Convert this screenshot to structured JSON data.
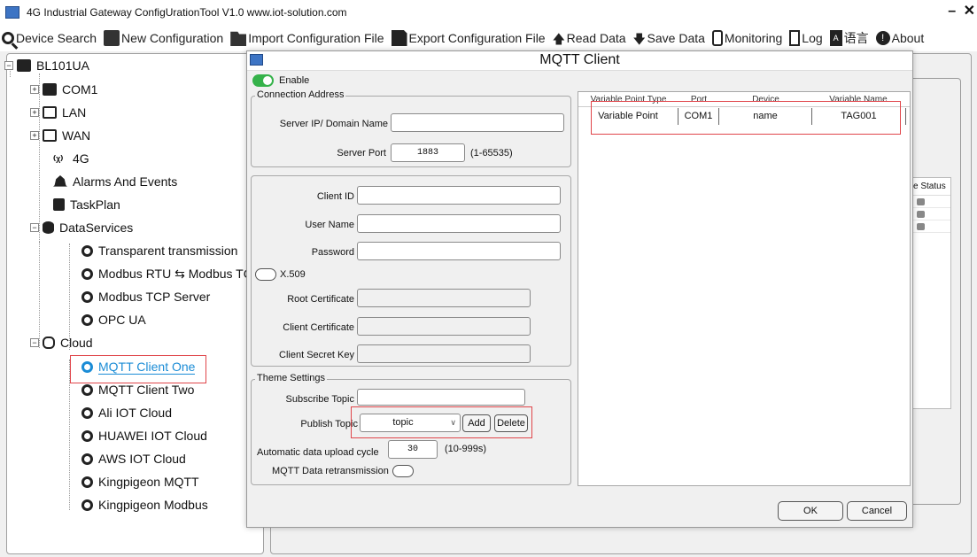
{
  "window": {
    "title": "4G Industrial Gateway ConfigUrationTool V1.0 www.iot-solution.com",
    "minimize": "–",
    "close": "✕"
  },
  "toolbar": {
    "items": [
      {
        "label": "Device Search",
        "icon": "search-icon"
      },
      {
        "label": "New Configuration",
        "icon": "new-config-icon"
      },
      {
        "label": "Import Configuration File",
        "icon": "folder-icon"
      },
      {
        "label": "Export Configuration File",
        "icon": "save-icon"
      },
      {
        "label": "Read Data",
        "icon": "arrow-up-icon"
      },
      {
        "label": "Save Data",
        "icon": "arrow-down-icon"
      },
      {
        "label": "Monitoring",
        "icon": "monitor-icon"
      },
      {
        "label": "Log",
        "icon": "log-icon"
      },
      {
        "label": "语言",
        "icon": "language-icon",
        "icon_text": "A"
      },
      {
        "label": "About",
        "icon": "info-icon",
        "icon_text": "!"
      }
    ]
  },
  "tree": {
    "root": "BL101UA",
    "items": [
      {
        "label": "COM1",
        "icon": "serial-port-icon"
      },
      {
        "label": "LAN",
        "icon": "lan-icon"
      },
      {
        "label": "WAN",
        "icon": "wan-icon"
      },
      {
        "label": "4G",
        "icon": "antenna-icon"
      },
      {
        "label": "Alarms And Events",
        "icon": "bell-icon"
      },
      {
        "label": "TaskPlan",
        "icon": "clipboard-icon"
      },
      {
        "label": "DataServices",
        "icon": "database-icon"
      },
      {
        "label": "Transparent transmission",
        "icon": "node-icon"
      },
      {
        "label": "Modbus RTU ⇆ Modbus TC",
        "icon": "node-icon"
      },
      {
        "label": "Modbus TCP Server",
        "icon": "node-icon"
      },
      {
        "label": "OPC UA",
        "icon": "node-icon"
      },
      {
        "label": "Cloud",
        "icon": "cloud-icon"
      },
      {
        "label": "MQTT Client One",
        "icon": "node-icon",
        "selected": true
      },
      {
        "label": "MQTT Client Two",
        "icon": "node-icon"
      },
      {
        "label": "Ali IOT Cloud",
        "icon": "node-icon"
      },
      {
        "label": "HUAWEI IOT Cloud",
        "icon": "node-icon"
      },
      {
        "label": "AWS IOT Cloud",
        "icon": "node-icon"
      },
      {
        "label": "Kingpigeon MQTT",
        "icon": "node-icon"
      },
      {
        "label": "Kingpigeon Modbus",
        "icon": "node-icon"
      }
    ]
  },
  "background": {
    "status_header": "e Status"
  },
  "dialog": {
    "title": "MQTT Client",
    "enable_label": "Enable",
    "enable_on": true,
    "connection": {
      "group_title": "Connection Address",
      "server_label": "Server IP/ Domain Name",
      "server_value": "",
      "port_label": "Server Port",
      "port_value": "1883",
      "port_hint": "(1-65535)"
    },
    "auth": {
      "client_id_label": "Client ID",
      "client_id_value": "",
      "user_label": "User Name",
      "user_value": "",
      "password_label": "Password",
      "password_value": "",
      "x509_label": "X.509",
      "x509_on": false,
      "root_cert_label": "Root Certificate",
      "client_cert_label": "Client Certificate",
      "secret_key_label": "Client Secret Key"
    },
    "theme": {
      "group_title": "Theme Settings",
      "subscribe_label": "Subscribe Topic",
      "subscribe_value": "",
      "publish_label": "Publish Topic",
      "publish_value": "topic",
      "add_label": "Add",
      "delete_label": "Delete",
      "cycle_label": "Automatic data upload cycle",
      "cycle_value": "30",
      "cycle_hint": "(10-999s)",
      "retrans_label": "MQTT Data retransmission",
      "retrans_on": false
    },
    "variables": {
      "columns": [
        "Variable Point Type",
        "Port",
        "Device",
        "Variable Name"
      ],
      "rows": [
        [
          "Variable Point",
          "COM1",
          "name",
          "TAG001"
        ]
      ]
    },
    "ok_label": "OK",
    "cancel_label": "Cancel"
  }
}
